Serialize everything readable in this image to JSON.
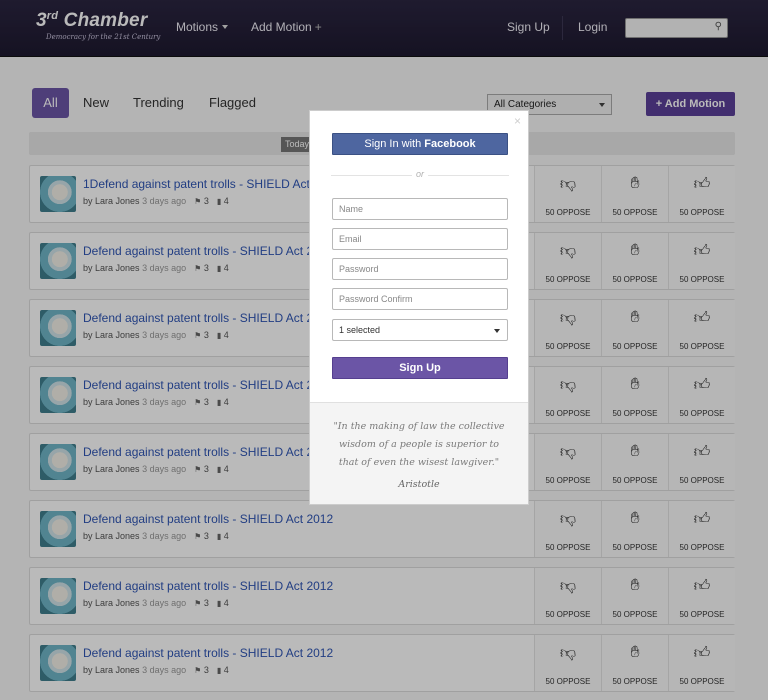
{
  "header": {
    "logo_text": "3",
    "logo_sup": "rd",
    "logo_rest": " Chamber",
    "tagline": "Democracy for the 21st Century",
    "nav": [
      {
        "label": "Motions"
      },
      {
        "label": "Add Motion"
      }
    ],
    "signup": "Sign Up",
    "login": "Login",
    "search_placeholder": ""
  },
  "filters": {
    "tabs": [
      "All",
      "New",
      "Trending",
      "Flagged"
    ],
    "active_tab": "All",
    "category": "All Categories",
    "add_motion": "+ Add Motion",
    "today": "Today"
  },
  "motions": [
    {
      "title": "1Defend against patent trolls - SHIELD Act 2012",
      "by": "by",
      "author": "Lara Jones",
      "time": "3 days ago",
      "flags": "3",
      "comments": "4",
      "votes": [
        "50 OPPOSE",
        "50 OPPOSE",
        "50 OPPOSE"
      ]
    },
    {
      "title": "Defend against patent trolls - SHIELD Act 2012",
      "by": "by",
      "author": "Lara Jones",
      "time": "3 days ago",
      "flags": "3",
      "comments": "4",
      "votes": [
        "50 OPPOSE",
        "50 OPPOSE",
        "50 OPPOSE"
      ]
    },
    {
      "title": "Defend against patent trolls - SHIELD Act 2012",
      "by": "by",
      "author": "Lara Jones",
      "time": "3 days ago",
      "flags": "3",
      "comments": "4",
      "votes": [
        "50 OPPOSE",
        "50 OPPOSE",
        "50 OPPOSE"
      ]
    },
    {
      "title": "Defend against patent trolls - SHIELD Act 2012",
      "by": "by",
      "author": "Lara Jones",
      "time": "3 days ago",
      "flags": "3",
      "comments": "4",
      "votes": [
        "50 OPPOSE",
        "50 OPPOSE",
        "50 OPPOSE"
      ]
    },
    {
      "title": "Defend against patent trolls - SHIELD Act 2012",
      "by": "by",
      "author": "Lara Jones",
      "time": "3 days ago",
      "flags": "3",
      "comments": "4",
      "votes": [
        "50 OPPOSE",
        "50 OPPOSE",
        "50 OPPOSE"
      ]
    },
    {
      "title": "Defend against patent trolls - SHIELD Act 2012",
      "by": "by",
      "author": "Lara Jones",
      "time": "3 days ago",
      "flags": "3",
      "comments": "4",
      "votes": [
        "50 OPPOSE",
        "50 OPPOSE",
        "50 OPPOSE"
      ]
    },
    {
      "title": "Defend against patent trolls - SHIELD Act 2012",
      "by": "by",
      "author": "Lara Jones",
      "time": "3 days ago",
      "flags": "3",
      "comments": "4",
      "votes": [
        "50 OPPOSE",
        "50 OPPOSE",
        "50 OPPOSE"
      ]
    },
    {
      "title": "Defend against patent trolls - SHIELD Act 2012",
      "by": "by",
      "author": "Lara Jones",
      "time": "3 days ago",
      "flags": "3",
      "comments": "4",
      "votes": [
        "50 OPPOSE",
        "50 OPPOSE",
        "50 OPPOSE"
      ]
    }
  ],
  "vote_icons": [
    "thumbs-down-icon",
    "raised-hand-icon",
    "thumbs-up-icon"
  ],
  "modal": {
    "close": "×",
    "facebook_prefix": "Sign In with ",
    "facebook_brand": "Facebook",
    "or": "or",
    "name_placeholder": "Name",
    "email_placeholder": "Email",
    "password_placeholder": "Password",
    "password_confirm_placeholder": "Password Confirm",
    "select_value": "1 selected",
    "signup": "Sign Up",
    "quote": "\"In the making of law the collective wisdom of a people is superior to that of even the wisest lawgiver.\"",
    "quote_author": "Aristotle"
  },
  "colors": {
    "header_bg": "#231e37",
    "accent": "#6b55a6",
    "facebook": "#4e66a0",
    "link": "#2f55b4"
  }
}
